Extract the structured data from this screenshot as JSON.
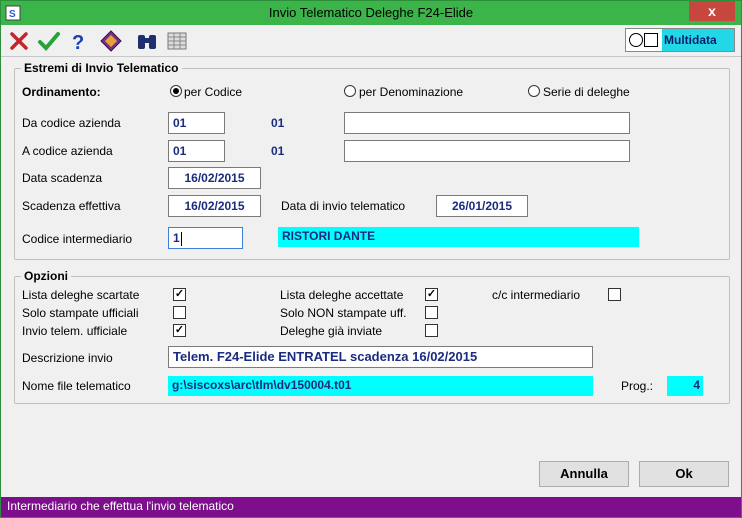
{
  "window": {
    "title": "Invio Telematico Deleghe F24-Elide",
    "close_label": "x"
  },
  "toolbar": {
    "logo_text": "Multidata"
  },
  "group1": {
    "legend": "Estremi di Invio Telematico",
    "ordinamento_label": "Ordinamento:",
    "radios": [
      {
        "label": "per Codice",
        "selected": true
      },
      {
        "label": "per Denominazione",
        "selected": false
      },
      {
        "label": "Serie di deleghe",
        "selected": false
      }
    ],
    "da_codice_label": "Da codice azienda",
    "da_codice_value": "01",
    "da_codice_static": "01",
    "da_codice_name": "",
    "a_codice_label": "A codice azienda",
    "a_codice_value": "01",
    "a_codice_static": "01",
    "a_codice_name": "",
    "data_scadenza_label": "Data scadenza",
    "data_scadenza_value": "16/02/2015",
    "scadenza_effettiva_label": "Scadenza effettiva",
    "scadenza_effettiva_value": "16/02/2015",
    "data_invio_label": "Data di invio telematico",
    "data_invio_value": "26/01/2015",
    "codice_intermediario_label": "Codice intermediario",
    "codice_intermediario_value": "1",
    "intermediario_name": "RISTORI DANTE"
  },
  "group2": {
    "legend": "Opzioni",
    "checks": [
      {
        "label": "Lista deleghe scartate",
        "checked": true
      },
      {
        "label": "Solo stampate ufficiali",
        "checked": false
      },
      {
        "label": "Invio telem. ufficiale",
        "checked": true
      },
      {
        "label": "Lista deleghe accettate",
        "checked": true
      },
      {
        "label": "Solo NON stampate uff.",
        "checked": false
      },
      {
        "label": "Deleghe già inviate",
        "checked": false
      },
      {
        "label": "c/c intermediario",
        "checked": false
      }
    ],
    "descrizione_label": "Descrizione invio",
    "descrizione_value": "Telem. F24-Elide ENTRATEL scadenza 16/02/2015",
    "nome_file_label": "Nome file telematico",
    "nome_file_value": "g:\\siscoxs\\arc\\tlm\\dv150004.t01",
    "prog_label": "Prog.:",
    "prog_value": "4"
  },
  "buttons": {
    "annulla": "Annulla",
    "ok": "Ok"
  },
  "status_text": "Intermediario che effettua l'invio telematico",
  "colors": {
    "titlebar": "#3bb54a",
    "status_bar": "#7d0f8c",
    "highlight": "#00ffff",
    "field_text": "#1a2b80"
  }
}
